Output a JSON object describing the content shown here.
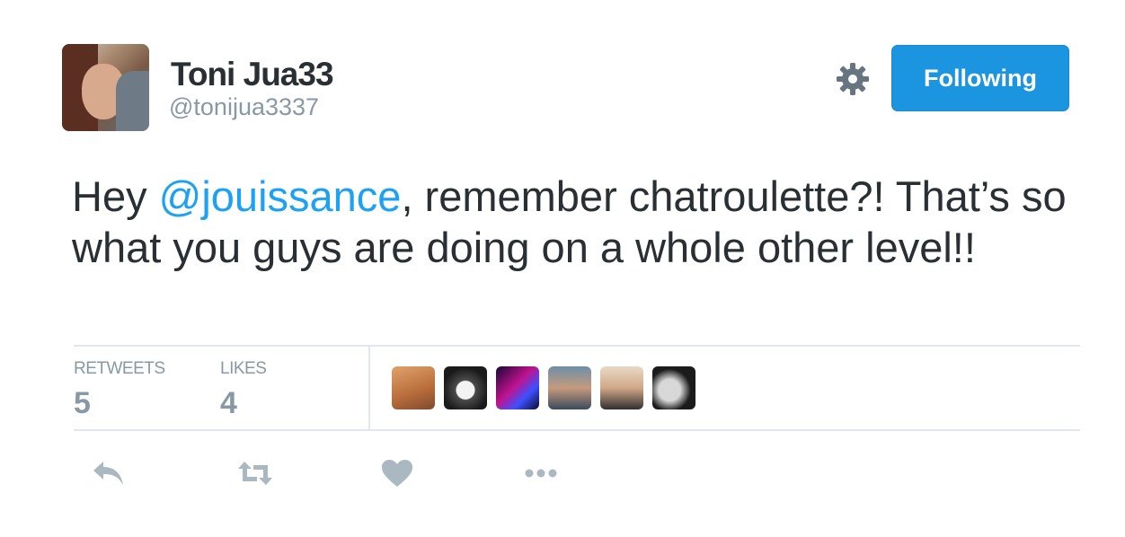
{
  "author": {
    "display_name": "Toni Jua33",
    "screen_name": "@tonijua3337",
    "avatar_icon": "avatar"
  },
  "header": {
    "settings_icon": "gear-icon",
    "follow_button_label": "Following",
    "follow_button_color": "#1b95e0"
  },
  "tweet": {
    "text_before": "Hey ",
    "mention": "@jouissance",
    "text_after": ", remember chatroulette?! That’s so what you guys are doing on a whole other level!!",
    "mention_color": "#1da1f2"
  },
  "stats": {
    "retweets_label": "RETWEETS",
    "retweets_count": "5",
    "likes_label": "LIKES",
    "likes_count": "4"
  },
  "likers": [
    "liker-avatar-1",
    "liker-avatar-2",
    "liker-avatar-3",
    "liker-avatar-4",
    "liker-avatar-5",
    "liker-avatar-6"
  ],
  "actions": {
    "reply_icon": "reply-icon",
    "retweet_icon": "retweet-icon",
    "like_icon": "heart-icon",
    "more_icon": "more-icon",
    "icon_color": "#aab8c2"
  }
}
